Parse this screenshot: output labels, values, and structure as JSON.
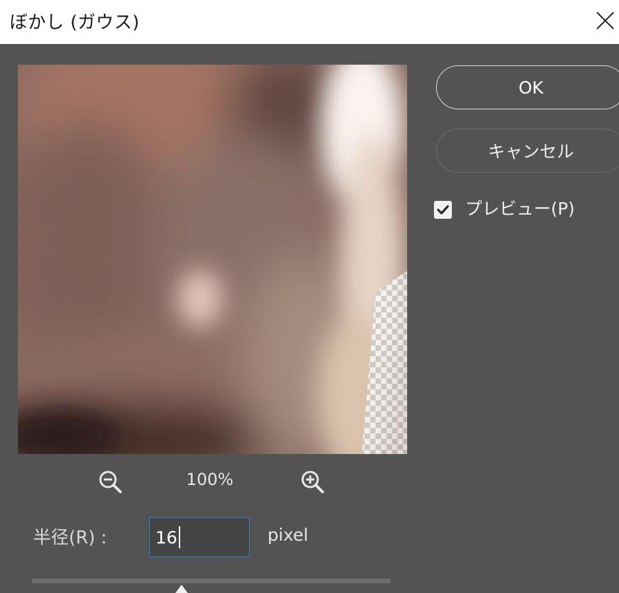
{
  "window": {
    "title": "ぼかし (ガウス)",
    "close_icon": "close-icon"
  },
  "preview": {
    "zoom_out_icon": "zoom-out-icon",
    "zoom_level": "100%",
    "zoom_in_icon": "zoom-in-icon"
  },
  "radius": {
    "label": "半径(R) :",
    "value": "16",
    "unit": "pixel",
    "slider_icon": "slider-thumb-icon"
  },
  "buttons": {
    "ok": "OK",
    "cancel": "キャンセル"
  },
  "preview_option": {
    "label": "プレビュー(P)",
    "checked": true,
    "check_icon": "checkmark-icon"
  },
  "colors": {
    "dialog_bg": "#535353",
    "titlebar_bg": "#ffffff",
    "input_focus_border": "#2f7fd4"
  }
}
